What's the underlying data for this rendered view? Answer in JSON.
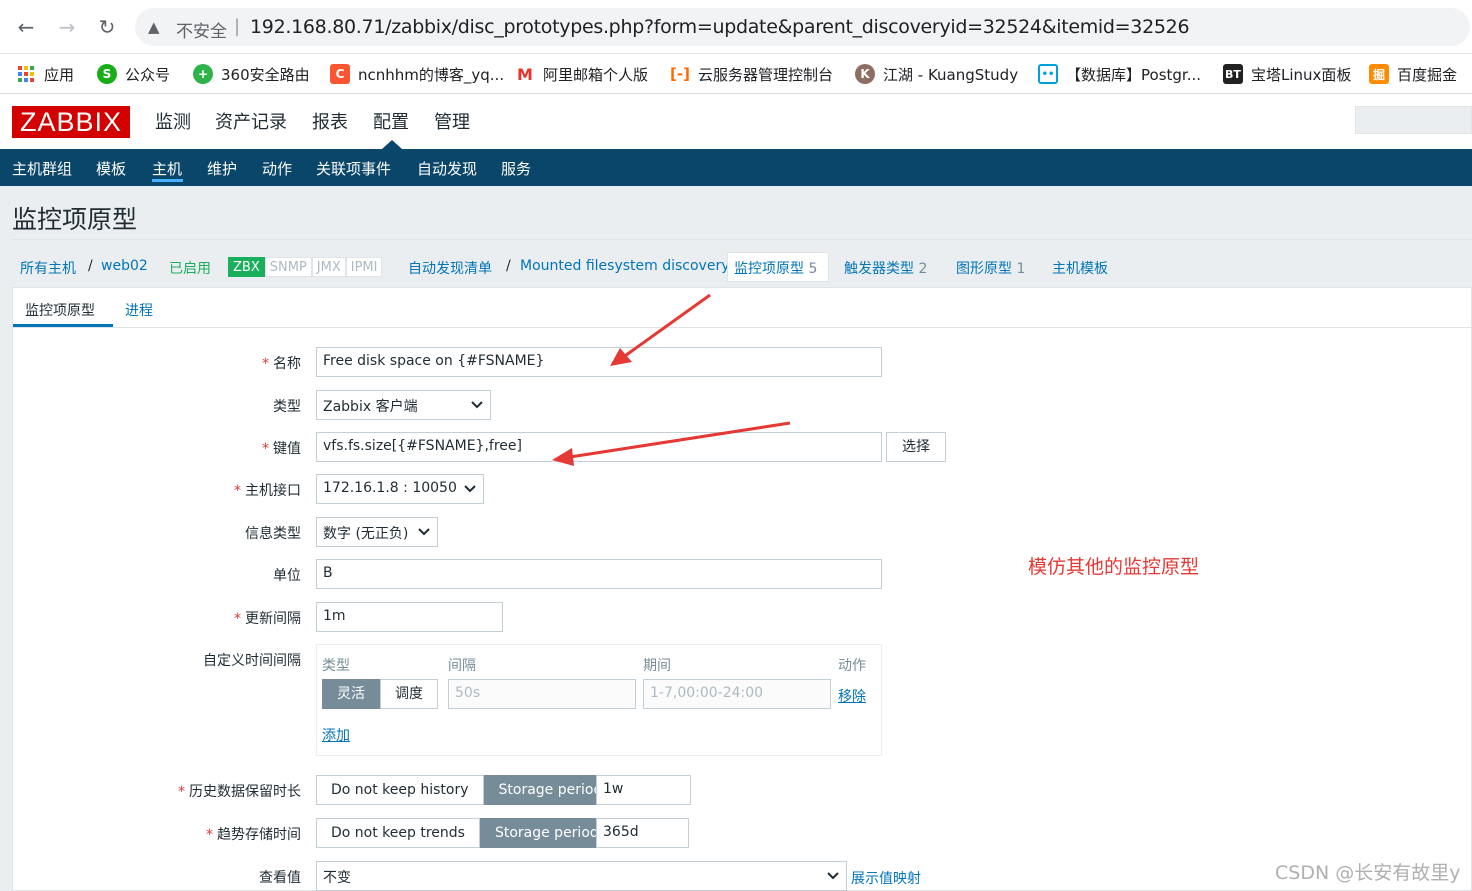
{
  "browser": {
    "back": "←",
    "forward": "→",
    "reload": "↻",
    "insecure_label": "不安全",
    "separator": "|",
    "url": "192.168.80.71/zabbix/disc_prototypes.php?form=update&parent_discoveryid=32524&itemid=32526",
    "bookmarks": [
      {
        "label": "应用",
        "icon": "apps-grid-icon",
        "color": "#ea4335"
      },
      {
        "label": "公众号",
        "icon": "wechat-icon",
        "color": "#1aad19"
      },
      {
        "label": "360安全路由",
        "icon": "360-icon",
        "color": "#2db34a"
      },
      {
        "label": "ncnhhm的博客_yq...",
        "icon": "csdn-icon",
        "color": "#fc5531"
      },
      {
        "label": "阿里邮箱个人版",
        "icon": "mail-icon",
        "color": "#e8332d"
      },
      {
        "label": "云服务器管理控制台",
        "icon": "aliyun-icon",
        "color": "#ff6a00"
      },
      {
        "label": "江湖 - KuangStudy",
        "icon": "kuang-icon",
        "color": "#8d6e63"
      },
      {
        "label": "【数据库】Postgr...",
        "icon": "bilibili-icon",
        "color": "#00a1d6"
      },
      {
        "label": "宝塔Linux面板",
        "icon": "bt-icon",
        "color": "#20a53a"
      },
      {
        "label": "百度掘金",
        "icon": "juejin-icon",
        "color": "#ff8c00"
      }
    ]
  },
  "zabbix": {
    "logo": "ZABBIX",
    "main_menu": [
      "监测",
      "资产记录",
      "报表",
      "配置",
      "管理"
    ],
    "sub_menu": [
      "主机群组",
      "模板",
      "主机",
      "维护",
      "动作",
      "关联项事件",
      "自动发现",
      "服务"
    ]
  },
  "page": {
    "title": "监控项原型",
    "breadcrumb": {
      "all_hosts": "所有主机",
      "sep": "/",
      "host": "web02",
      "status": "已启用",
      "availability": [
        "ZBX",
        "SNMP",
        "JMX",
        "IPMI"
      ],
      "discovery_list": "自动发现清单",
      "discovery_rule": "Mounted filesystem discovery",
      "item_prototypes": "监控项原型",
      "item_prototypes_count": "5",
      "trigger_prototypes": "触发器类型",
      "trigger_prototypes_count": "2",
      "graph_prototypes": "图形原型",
      "graph_prototypes_count": "1",
      "host_prototypes": "主机模板"
    },
    "tabs": [
      "监控项原型",
      "进程"
    ]
  },
  "form": {
    "required_mark": "*",
    "name_label": "名称",
    "name_value": "Free disk space on {#FSNAME}",
    "type_label": "类型",
    "type_value": "Zabbix 客户端",
    "key_label": "键值",
    "key_value": "vfs.fs.size[{#FSNAME},free]",
    "key_select_btn": "选择",
    "interface_label": "主机接口",
    "interface_value": "172.16.1.8 : 10050",
    "info_type_label": "信息类型",
    "info_type_value": "数字 (无正负)",
    "units_label": "单位",
    "units_value": "B",
    "interval_label": "更新间隔",
    "interval_value": "1m",
    "custom_intervals_label": "自定义时间间隔",
    "custom_intervals": {
      "col_type": "类型",
      "col_interval": "间隔",
      "col_period": "期间",
      "col_action": "动作",
      "flexible": "灵活",
      "scheduling": "调度",
      "interval_placeholder": "50s",
      "period_placeholder": "1-7,00:00-24:00",
      "remove": "移除",
      "add": "添加"
    },
    "history_label": "历史数据保留时长",
    "history_no_keep": "Do not keep history",
    "history_storage": "Storage period",
    "history_value": "1w",
    "trends_label": "趋势存储时间",
    "trends_no_keep": "Do not keep trends",
    "trends_storage": "Storage period",
    "trends_value": "365d",
    "valuemap_label": "查看值",
    "valuemap_value": "不变",
    "valuemap_link": "展示值映射"
  },
  "annotation": "模仿其他的监控原型",
  "watermark": "CSDN @长安有故里y",
  "colors": {
    "zabbix_red": "#d40000",
    "nav_blue": "#0a466a",
    "link_blue": "#0275b8",
    "green": "#1aaf5d",
    "arrow_red": "#e53935"
  }
}
